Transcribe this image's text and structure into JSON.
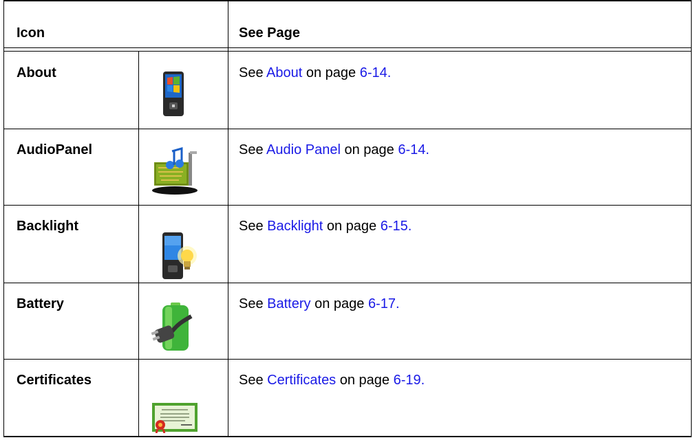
{
  "header": {
    "icon": "Icon",
    "see_page": "See Page"
  },
  "rows": [
    {
      "name": "About",
      "icon": "pocket-pc-windows-icon",
      "prefix": "See ",
      "link": "About",
      "mid": " on page ",
      "page": "6-14."
    },
    {
      "name": "AudioPanel",
      "icon": "audio-card-icon",
      "prefix": "See ",
      "link": "Audio Panel",
      "mid": " on page ",
      "page": "6-14."
    },
    {
      "name": "Backlight",
      "icon": "phone-lightbulb-icon",
      "prefix": "See ",
      "link": "Backlight",
      "mid": " on page ",
      "page": "6-15."
    },
    {
      "name": "Battery",
      "icon": "battery-plug-icon",
      "prefix": "See ",
      "link": "Battery",
      "mid": " on page ",
      "page": "6-17."
    },
    {
      "name": "Certificates",
      "icon": "certificate-icon",
      "prefix": "See ",
      "link": "Certificates",
      "mid": " on page ",
      "page": "6-19."
    }
  ],
  "colors": {
    "link": "#1a1ae6",
    "border": "#000000"
  }
}
